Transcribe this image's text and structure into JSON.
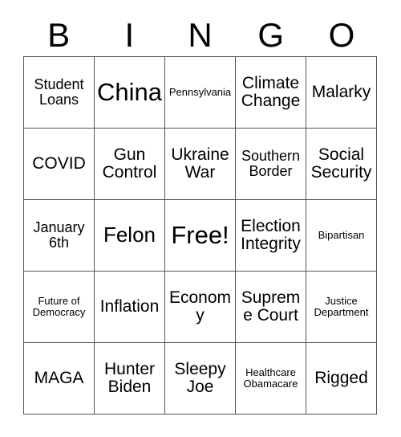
{
  "card": {
    "title_letters": [
      "B",
      "I",
      "N",
      "G",
      "O"
    ],
    "rows": [
      [
        {
          "label": "Student Loans",
          "size": "sm"
        },
        {
          "label": "China",
          "size": "xl"
        },
        {
          "label": "Pennsylvania",
          "size": "xs"
        },
        {
          "label": "Climate Change",
          "size": "md"
        },
        {
          "label": "Malarky",
          "size": "md"
        }
      ],
      [
        {
          "label": "COVID",
          "size": "md"
        },
        {
          "label": "Gun Control",
          "size": "md"
        },
        {
          "label": "Ukraine War",
          "size": "md"
        },
        {
          "label": "Southern Border",
          "size": "sm"
        },
        {
          "label": "Social Security",
          "size": "md"
        }
      ],
      [
        {
          "label": "January 6th",
          "size": "sm"
        },
        {
          "label": "Felon",
          "size": "lg"
        },
        {
          "label": "Free!",
          "size": "xl"
        },
        {
          "label": "Election Integrity",
          "size": "md"
        },
        {
          "label": "Bipartisan",
          "size": "xs"
        }
      ],
      [
        {
          "label": "Future of Democracy",
          "size": "xs"
        },
        {
          "label": "Inflation",
          "size": "md"
        },
        {
          "label": "Economy",
          "size": "md"
        },
        {
          "label": "Supreme Court",
          "size": "md"
        },
        {
          "label": "Justice Department",
          "size": "xs"
        }
      ],
      [
        {
          "label": "MAGA",
          "size": "md"
        },
        {
          "label": "Hunter Biden",
          "size": "md"
        },
        {
          "label": "Sleepy Joe",
          "size": "md"
        },
        {
          "label": "Healthcare Obamacare",
          "size": "xs"
        },
        {
          "label": "Rigged",
          "size": "md"
        }
      ]
    ]
  },
  "colors": {
    "background": "#ffffff",
    "text": "#000000",
    "border": "#555555"
  }
}
